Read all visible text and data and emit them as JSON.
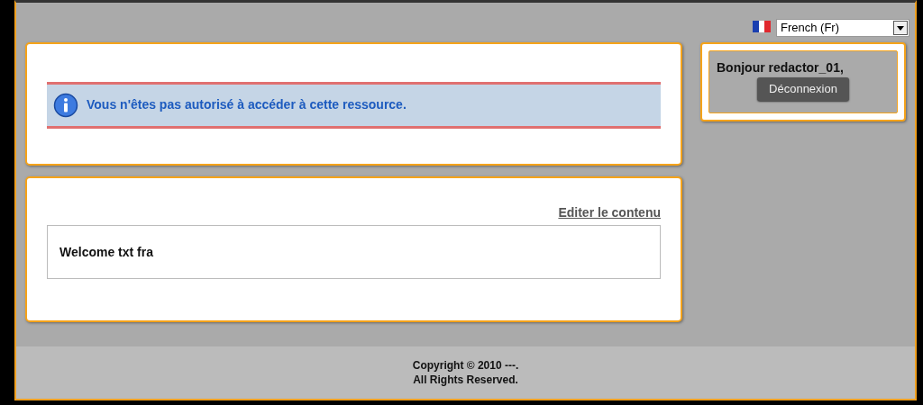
{
  "language_selector": {
    "value": "French (Fr)"
  },
  "alert": {
    "message": "Vous n'êtes pas autorisé à accéder à cette ressource."
  },
  "content": {
    "edit_link": "Editer le contenu",
    "text": "Welcome txt fra"
  },
  "user_panel": {
    "greeting": "Bonjour redactor_01,",
    "logout_button": "Déconnexion"
  },
  "footer": {
    "lines": [
      "Copyright © 2010 ---.",
      "All Rights Reserved."
    ]
  }
}
